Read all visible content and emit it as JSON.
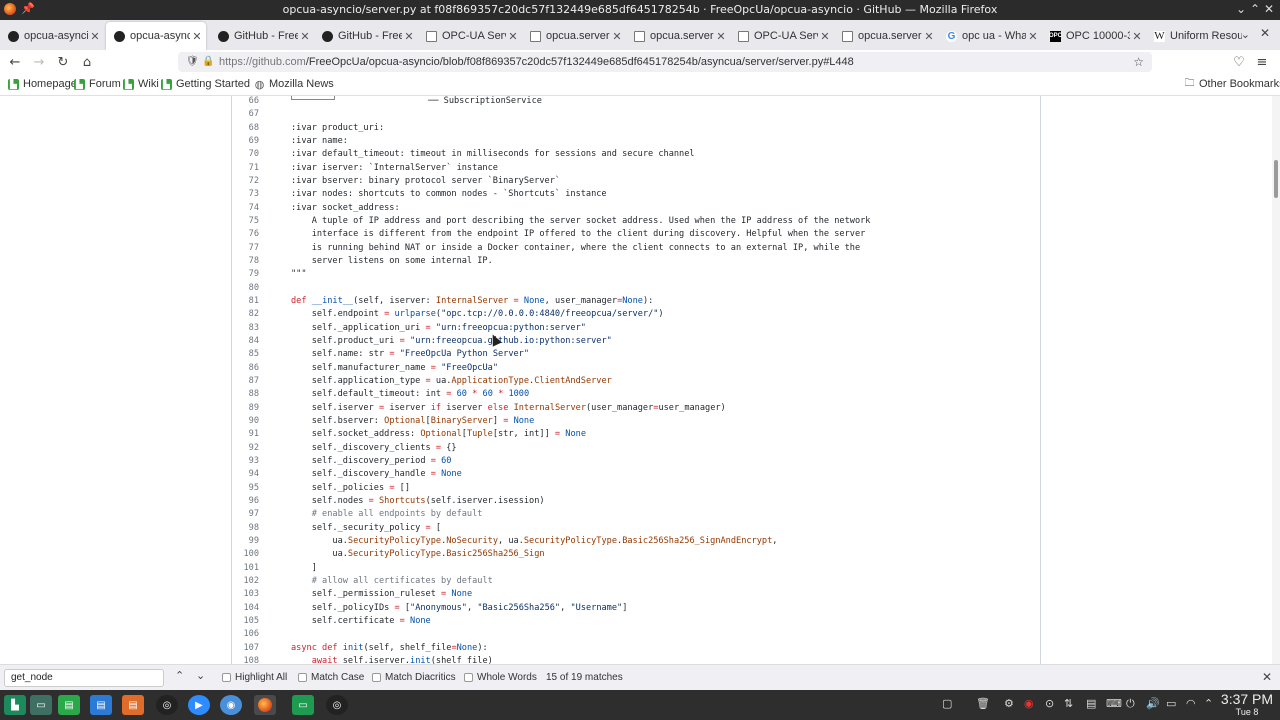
{
  "window": {
    "title": "opcua-asyncio/server.py at f08f869357c20dc57f132449e685df645178254b · FreeOpcUa/opcua-asyncio · GitHub — Mozilla Firefox"
  },
  "tabs": [
    {
      "label": "opcua-asyncio/",
      "icon": "github-icon",
      "active": false
    },
    {
      "label": "opcua-asyncio",
      "icon": "github-icon",
      "active": true
    },
    {
      "label": "GitHub - FreeO",
      "icon": "github-icon",
      "active": false
    },
    {
      "label": "GitHub - FreeOp",
      "icon": "github-icon",
      "active": false
    },
    {
      "label": "OPC-UA Server",
      "icon": "document-icon",
      "active": false
    },
    {
      "label": "opcua.server.se",
      "icon": "document-icon",
      "active": false
    },
    {
      "label": "opcua.server.se",
      "icon": "document-icon",
      "active": false
    },
    {
      "label": "OPC-UA Server",
      "icon": "document-icon",
      "active": false
    },
    {
      "label": "opcua.server.se",
      "icon": "document-icon",
      "active": false
    },
    {
      "label": "opc ua - What i",
      "icon": "google-icon",
      "active": false
    },
    {
      "label": "OPC 10000-3 U",
      "icon": "opc-icon",
      "active": false
    },
    {
      "label": "Uniform Resour",
      "icon": "wikipedia-icon",
      "active": false
    }
  ],
  "navbar": {
    "url_host": "https://github.com",
    "url_path": "/FreeOpcUa/opcua-asyncio/blob/f08f869357c20dc57f132449e685df645178254b/asyncua/server/server.py#L448"
  },
  "bookmarks": [
    {
      "label": "Homepage"
    },
    {
      "label": "Forum"
    },
    {
      "label": "Wiki"
    },
    {
      "label": "Getting Started"
    },
    {
      "label": "Mozilla News"
    }
  ],
  "other_bookmarks": "Other Bookmarks",
  "code_lines": [
    {
      "n": "66",
      "html": "<span style=\"display:inline-block;width:44px;height:5px;border:1px solid #888;border-top:none;vertical-align:top\"></span>                  ── SubscriptionService"
    },
    {
      "n": "67",
      "html": ""
    },
    {
      "n": "68",
      "html": ":ivar product_uri:"
    },
    {
      "n": "69",
      "html": ":ivar name:"
    },
    {
      "n": "70",
      "html": ":ivar default_timeout: timeout in milliseconds for sessions and secure channel"
    },
    {
      "n": "71",
      "html": ":ivar iserver: `InternalServer` instance"
    },
    {
      "n": "72",
      "html": ":ivar bserver: binary protocol server `BinaryServer`"
    },
    {
      "n": "73",
      "html": ":ivar nodes: shortcuts to common nodes - `Shortcuts` instance"
    },
    {
      "n": "74",
      "html": ":ivar socket_address:"
    },
    {
      "n": "75",
      "html": "    A tuple of IP address and port describing the server socket address. Used when the IP address of the network"
    },
    {
      "n": "76",
      "html": "    interface is different from the endpoint IP offered to the client during discovery. Helpful when the server"
    },
    {
      "n": "77",
      "html": "    is running behind NAT or inside a Docker container, where the client connects to an external IP, while the"
    },
    {
      "n": "78",
      "html": "    server listens on some internal IP."
    },
    {
      "n": "79",
      "html": "\"\"\""
    },
    {
      "n": "80",
      "html": ""
    },
    {
      "n": "81",
      "html": "<span class=\"kw\">def</span> <span class=\"nu\">__init__</span>(self, iserver: <span class=\"cls\">InternalServer</span> <span class=\"kw\">=</span> <span class=\"nu\">None</span>, user_manager<span class=\"kw\">=</span><span class=\"nu\">None</span>):"
    },
    {
      "n": "82",
      "html": "    self.endpoint <span class=\"kw\">=</span> <span class=\"nu\">urlparse</span>(<span class=\"st\">\"opc.tcp://0.0.0.0:4840/freeopcua/server/\"</span>)"
    },
    {
      "n": "83",
      "html": "    self._application_uri <span class=\"kw\">=</span> <span class=\"st\">\"urn:freeopcua:python:server\"</span>"
    },
    {
      "n": "84",
      "html": "    self.product_uri <span class=\"kw\">=</span> <span class=\"st\">\"urn:freeopcua.github.io:python:server\"</span>"
    },
    {
      "n": "85",
      "html": "    self.name: str <span class=\"kw\">=</span> <span class=\"st\">\"FreeOpcUa Python Server\"</span>"
    },
    {
      "n": "86",
      "html": "    self.manufacturer_name <span class=\"kw\">=</span> <span class=\"st\">\"FreeOpcUa\"</span>"
    },
    {
      "n": "87",
      "html": "    self.application_type <span class=\"kw\">=</span> ua.<span class=\"cls\">ApplicationType</span>.<span class=\"cls\">ClientAndServer</span>"
    },
    {
      "n": "88",
      "html": "    self.default_timeout: int <span class=\"kw\">=</span> <span class=\"nu\">60</span> <span class=\"kw\">*</span> <span class=\"nu\">60</span> <span class=\"kw\">*</span> <span class=\"nu\">1000</span>"
    },
    {
      "n": "89",
      "html": "    self.iserver <span class=\"kw\">=</span> iserver <span class=\"kw\">if</span> iserver <span class=\"kw\">else</span> <span class=\"cls\">InternalServer</span>(user_manager<span class=\"kw\">=</span>user_manager)"
    },
    {
      "n": "90",
      "html": "    self.bserver: <span class=\"cls\">Optional</span>[<span class=\"cls\">BinaryServer</span>] <span class=\"kw\">=</span> <span class=\"nu\">None</span>"
    },
    {
      "n": "91",
      "html": "    self.socket_address: <span class=\"cls\">Optional</span>[<span class=\"cls\">Tuple</span>[str, int]] <span class=\"kw\">=</span> <span class=\"nu\">None</span>"
    },
    {
      "n": "92",
      "html": "    self._discovery_clients <span class=\"kw\">=</span> {}"
    },
    {
      "n": "93",
      "html": "    self._discovery_period <span class=\"kw\">=</span> <span class=\"nu\">60</span>"
    },
    {
      "n": "94",
      "html": "    self._discovery_handle <span class=\"kw\">=</span> <span class=\"nu\">None</span>"
    },
    {
      "n": "95",
      "html": "    self._policies <span class=\"kw\">=</span> []"
    },
    {
      "n": "96",
      "html": "    self.nodes <span class=\"kw\">=</span> <span class=\"cls\">Shortcuts</span>(self.iserver.isession)"
    },
    {
      "n": "97",
      "html": "    <span class=\"cm\"># enable all endpoints by default</span>"
    },
    {
      "n": "98",
      "html": "    self._security_policy <span class=\"kw\">=</span> ["
    },
    {
      "n": "99",
      "html": "        ua.<span class=\"cls\">SecurityPolicyType</span>.<span class=\"cls\">NoSecurity</span>, ua.<span class=\"cls\">SecurityPolicyType</span>.<span class=\"cls\">Basic256Sha256_SignAndEncrypt</span>,"
    },
    {
      "n": "100",
      "html": "        ua.<span class=\"cls\">SecurityPolicyType</span>.<span class=\"cls\">Basic256Sha256_Sign</span>"
    },
    {
      "n": "101",
      "html": "    ]"
    },
    {
      "n": "102",
      "html": "    <span class=\"cm\"># allow all certificates by default</span>"
    },
    {
      "n": "103",
      "html": "    self._permission_ruleset <span class=\"kw\">=</span> <span class=\"nu\">None</span>"
    },
    {
      "n": "104",
      "html": "    self._policyIDs <span class=\"kw\">=</span> [<span class=\"st\">\"Anonymous\"</span>, <span class=\"st\">\"Basic256Sha256\"</span>, <span class=\"st\">\"Username\"</span>]"
    },
    {
      "n": "105",
      "html": "    self.certificate <span class=\"kw\">=</span> <span class=\"nu\">None</span>"
    },
    {
      "n": "106",
      "html": ""
    },
    {
      "n": "107",
      "html": "<span class=\"kw\">async def</span> <span class=\"nu\">init</span>(self, shelf_file<span class=\"kw\">=</span><span class=\"nu\">None</span>):"
    },
    {
      "n": "108",
      "html": "    <span class=\"kw\">await</span> self.iserver.<span class=\"nu\">init</span>(shelf_file)"
    }
  ],
  "findbar": {
    "query": "get_node",
    "highlight_all": "Highlight All",
    "match_case": "Match Case",
    "match_diacritics": "Match Diacritics",
    "whole_words": "Whole Words",
    "count": "15 of 19 matches"
  },
  "clock": {
    "time": "3:37 PM",
    "date": "Tue 8"
  }
}
